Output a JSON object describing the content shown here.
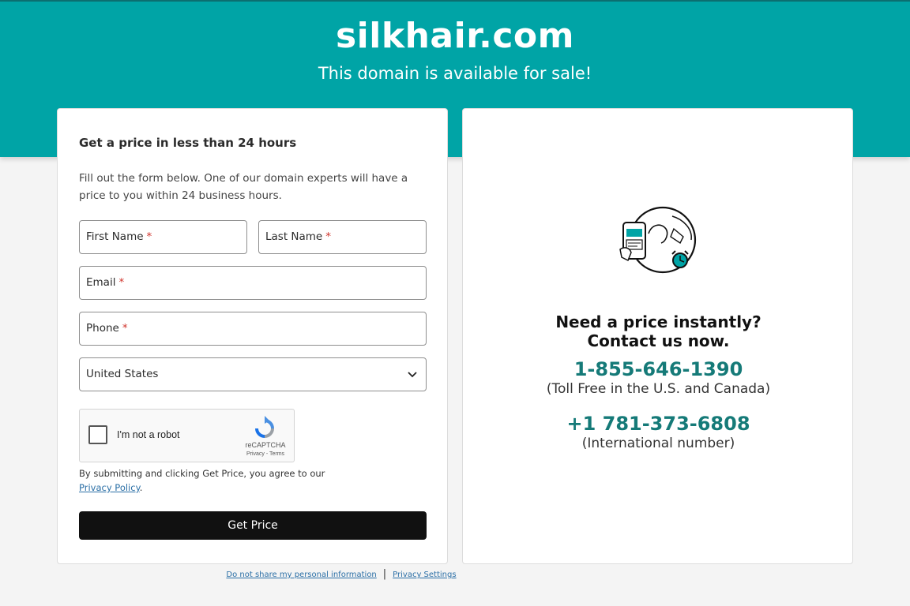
{
  "header": {
    "domain": "silkhair.com",
    "subtitle": "This domain is available for sale!"
  },
  "form": {
    "heading": "Get a price in less than 24 hours",
    "description": "Fill out the form below. One of our domain experts will have a price to you within 24 business hours.",
    "first_name_label": "First Name",
    "last_name_label": "Last Name",
    "email_label": "Email",
    "phone_label": "Phone",
    "required_mark": "*",
    "country_value": "United States",
    "captcha_label": "I'm not a robot",
    "captcha_brand": "reCAPTCHA",
    "captcha_links": "Privacy - Terms",
    "agree_text": "By submitting and clicking Get Price, you agree to our",
    "privacy_link": "Privacy Policy",
    "agree_end": ".",
    "submit_label": "Get Price"
  },
  "contact": {
    "heading_line1": "Need a price instantly?",
    "heading_line2": "Contact us now.",
    "tollfree_number": "1-855-646-1390",
    "tollfree_note": "(Toll Free in the U.S. and Canada)",
    "intl_number": "+1 781-373-6808",
    "intl_note": "(International number)"
  },
  "footer": {
    "do_not_share": "Do not share my personal information",
    "separator": "|",
    "privacy_settings": "Privacy Settings"
  },
  "colors": {
    "brand_teal": "#00a4a6",
    "phone_teal": "#157a78",
    "button_black": "#111111"
  }
}
